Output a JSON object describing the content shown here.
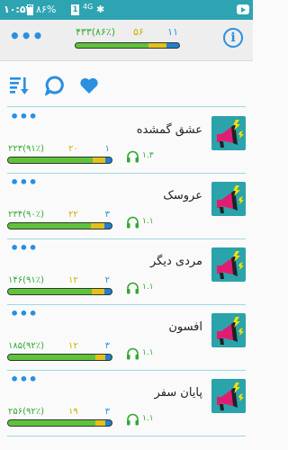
{
  "status": {
    "time": "۱۰:۵۲",
    "battery": "۸۶%",
    "sim": "1",
    "network": "4G"
  },
  "header": {
    "menu_icon": "more-dots-icon",
    "count_left": "۴۳۳(۸۶٪)",
    "count_mid": "۵۶",
    "count_right": "۱۱",
    "progress": {
      "green": 0.7,
      "yellow": 0.18,
      "blue": 0.12
    },
    "info_label": "i"
  },
  "toolbar": {
    "sort_icon": "sort-icon",
    "comment_icon": "comment-icon",
    "favorite_icon": "heart-icon"
  },
  "colors": {
    "accent": "#2a8fe0",
    "green": "#5fc33a",
    "yellow": "#e2c21a",
    "status": "#2ea4b2"
  },
  "items": [
    {
      "title": "عشق گمشده",
      "left": "۲۲۳(۹۱٪)",
      "mid": "۲۰",
      "right": "۱",
      "duration": "۱.۳",
      "progress": {
        "green": 0.82,
        "yellow": 0.12,
        "blue": 0.06
      }
    },
    {
      "title": "عروسک",
      "left": "۲۳۴(۹۰٪)",
      "mid": "۲۲",
      "right": "۳",
      "duration": "۱.۱",
      "progress": {
        "green": 0.8,
        "yellow": 0.13,
        "blue": 0.07
      }
    },
    {
      "title": "مردی دیگر",
      "left": "۱۴۶(۹۱٪)",
      "mid": "۱۲",
      "right": "۲",
      "duration": "۱.۱",
      "progress": {
        "green": 0.81,
        "yellow": 0.12,
        "blue": 0.07
      }
    },
    {
      "title": "افسون",
      "left": "۱۸۵(۹۲٪)",
      "mid": "۱۲",
      "right": "۳",
      "duration": "۱.۱",
      "progress": {
        "green": 0.84,
        "yellow": 0.1,
        "blue": 0.06
      }
    },
    {
      "title": "پایان سفر",
      "left": "۲۵۶(۹۲٪)",
      "mid": "۱۹",
      "right": "۳",
      "duration": "۱.۱",
      "progress": {
        "green": 0.84,
        "yellow": 0.1,
        "blue": 0.06
      }
    }
  ]
}
